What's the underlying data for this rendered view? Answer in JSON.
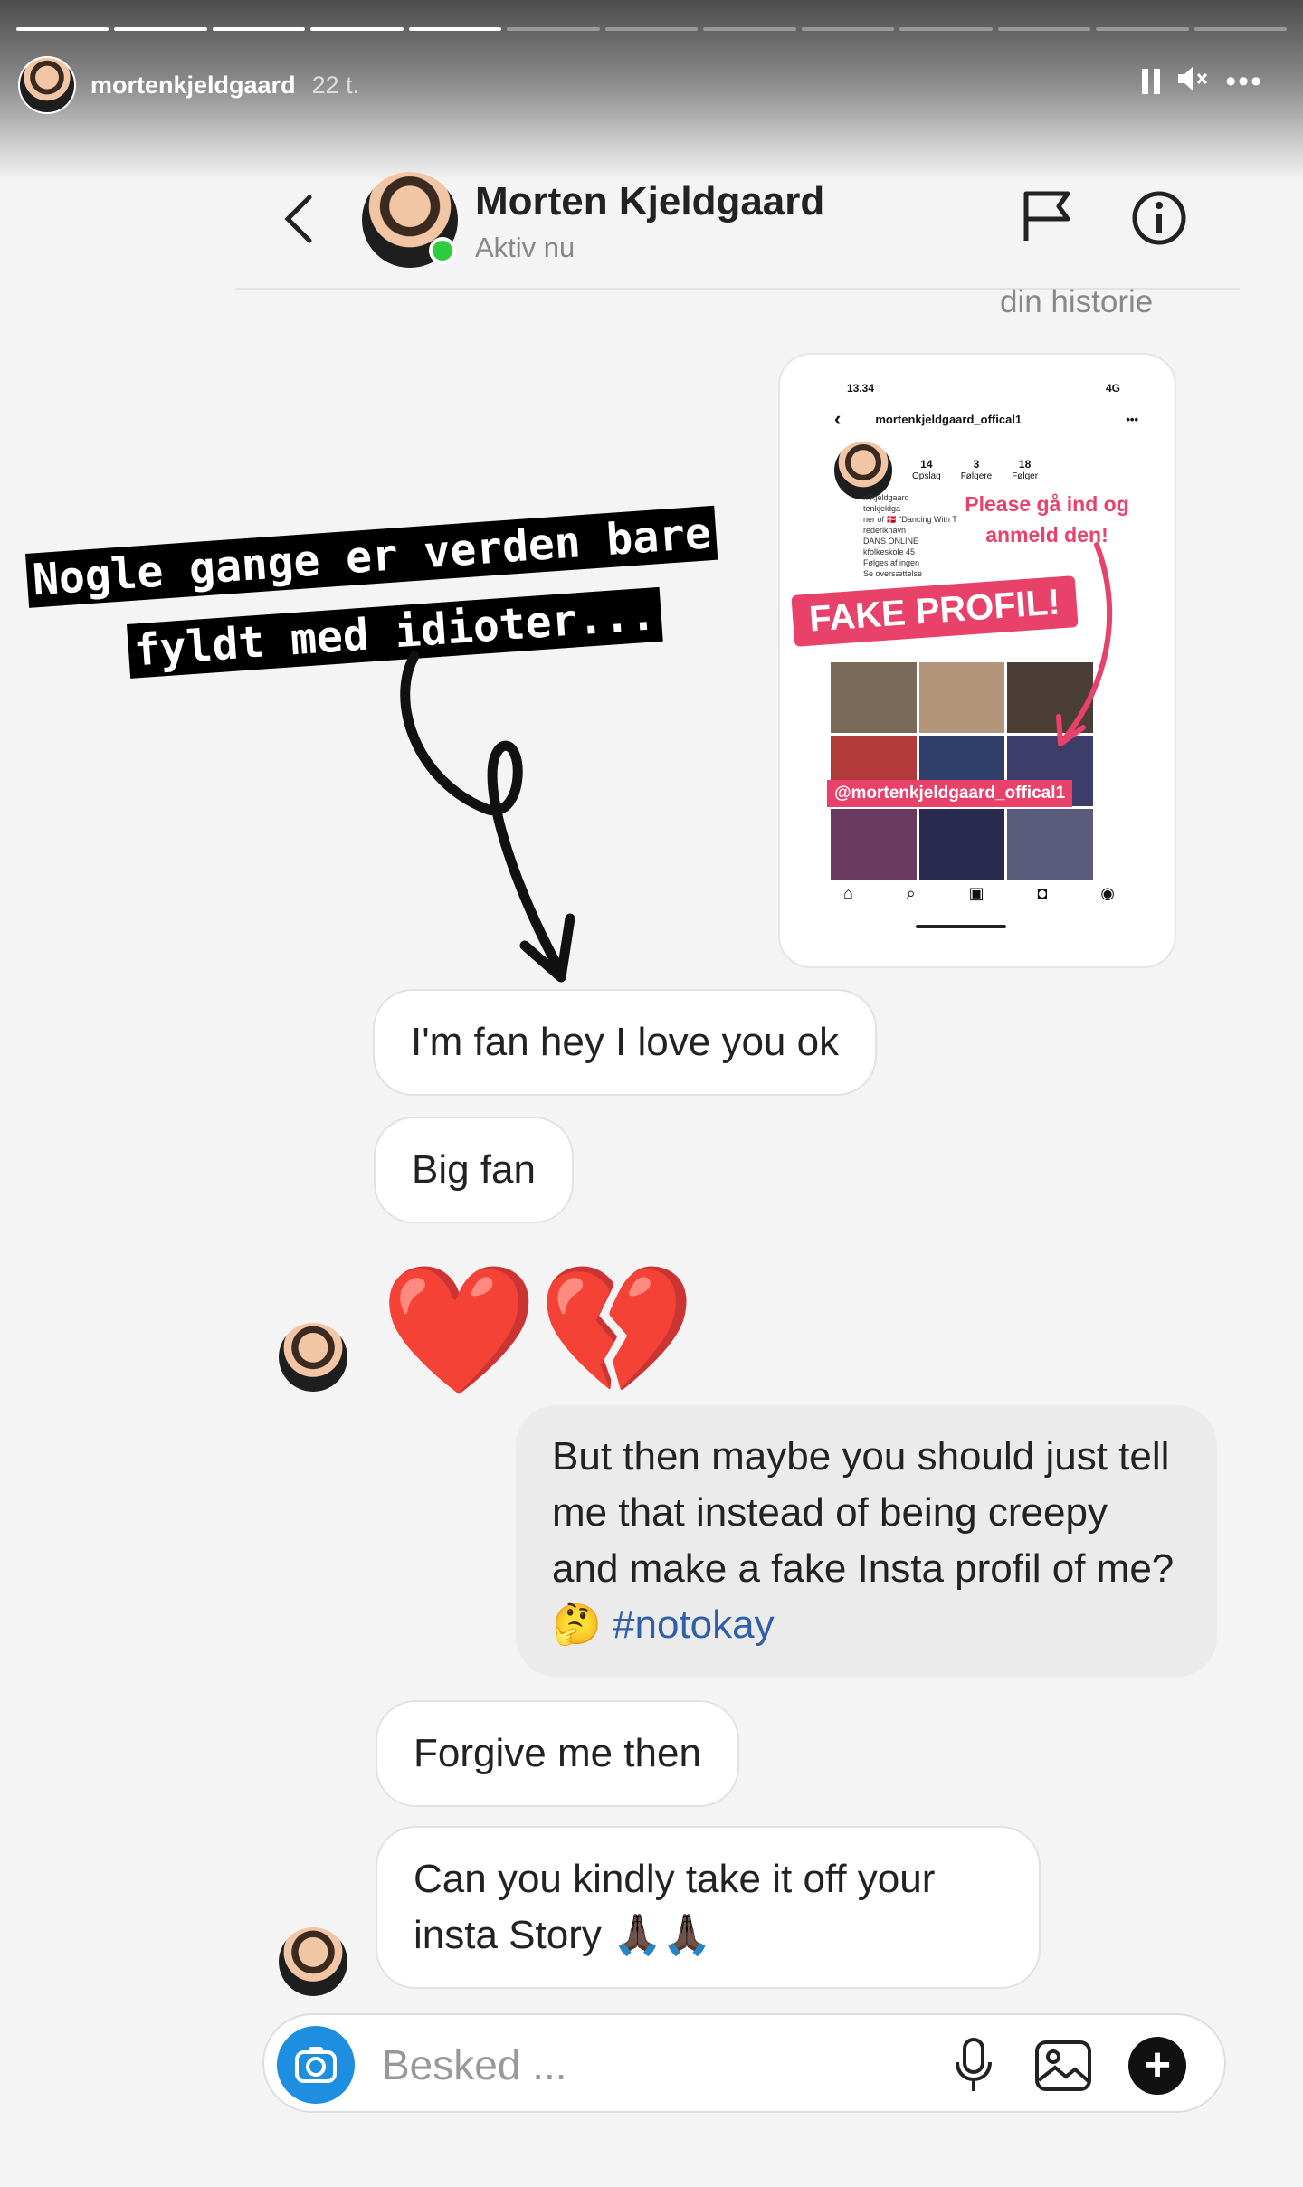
{
  "story": {
    "username": "mortenkjeldgaard",
    "time": "22 t.",
    "segments_total": 13,
    "segments_done": 5
  },
  "dm_header": {
    "name": "Morten Kjeldgaard",
    "status": "Aktiv nu"
  },
  "story_reply_label": "din historie",
  "phone_screenshot": {
    "time": "13.34",
    "signal": "4G",
    "username": "mortenkjeldgaard_offical1",
    "stats": [
      {
        "value": "14",
        "label": "Opslag"
      },
      {
        "value": "3",
        "label": "Følgere"
      },
      {
        "value": "18",
        "label": "Følger"
      }
    ],
    "bio_lines": [
      "n Kjeldgaard",
      "tenkjeldga",
      "ner of 🇩🇰 \"Dancing With T",
      "rederikhavn",
      "DANS ONLINE",
      "kfolkeskole 45",
      "Følges af ingen",
      "Se oversættelse"
    ],
    "note_line1": "Please gå ind og",
    "note_line2": "anmeld den!",
    "badge": "FAKE PROFIL!",
    "handle_tag": "@mortenkjeldgaard_offical1"
  },
  "caption": {
    "line1": "Nogle gange er verden bare",
    "line2": "fyldt med idioter..."
  },
  "messages": [
    {
      "text": "I'm fan hey I love you ok"
    },
    {
      "text": "Big fan"
    },
    {
      "text": "❤️💔"
    },
    {
      "text": "But then maybe you should just tell me that instead of being creepy and make a fake Insta profil of me? 🤔",
      "hashtag": "#notokay"
    },
    {
      "text": "Forgive me then"
    },
    {
      "text": "Can you kindly take it off your insta Story 🙏🏿🙏🏿"
    }
  ],
  "composer": {
    "placeholder": "Besked ..."
  },
  "icons": [
    "pause-icon",
    "mute-icon",
    "more-icon",
    "back-icon",
    "flag-icon",
    "info-icon",
    "camera-icon",
    "mic-icon",
    "gallery-icon",
    "plus-icon"
  ],
  "colors": {
    "online": "#2ecc40",
    "camera": "#1e8fe0",
    "fake_badge": "#e8426a",
    "hashtag": "#2f5fa7"
  }
}
